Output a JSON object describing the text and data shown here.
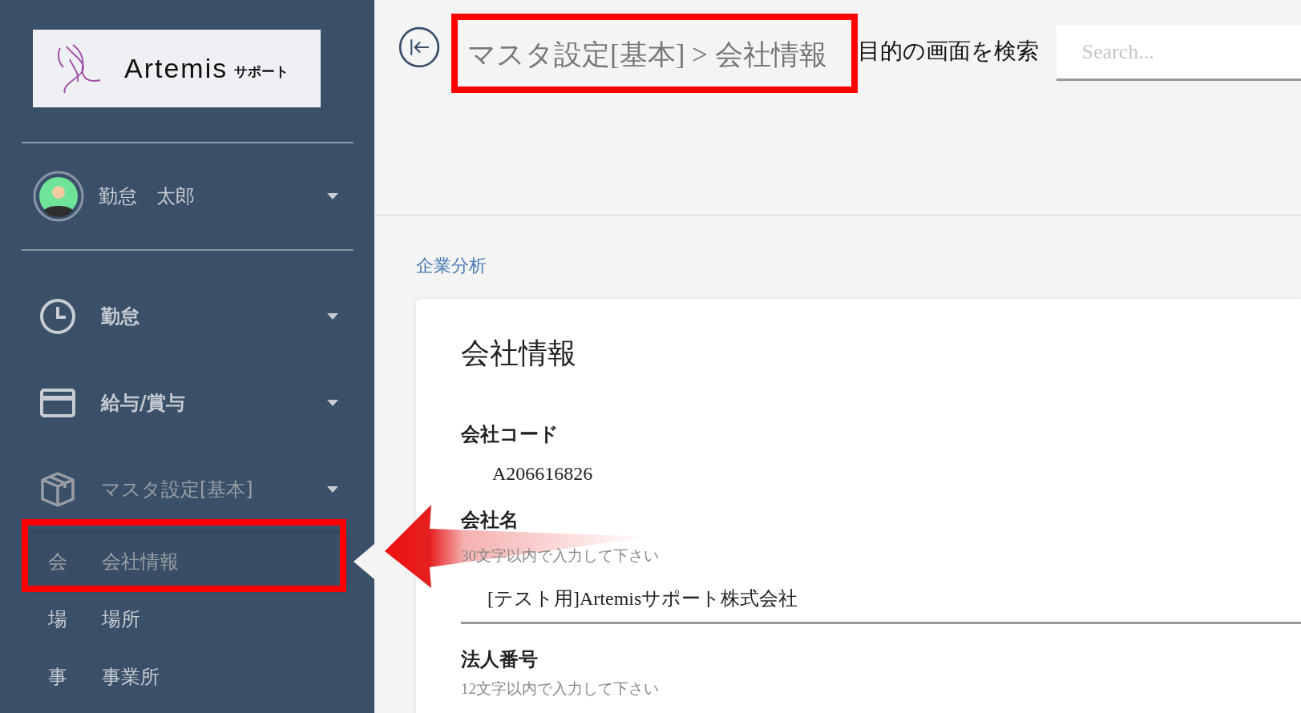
{
  "sidebar": {
    "logo": {
      "name": "Artemis",
      "suffix": "サポート"
    },
    "user": {
      "name": "勤怠　太郎"
    },
    "nav": [
      {
        "label": "勤怠",
        "kind": "clock",
        "expanded": false
      },
      {
        "label": "給与/賞与",
        "kind": "card",
        "expanded": false
      },
      {
        "label": "マスタ設定[基本]",
        "kind": "box",
        "expanded": true,
        "children": [
          {
            "initial": "会",
            "label": "会社情報",
            "selected": true
          },
          {
            "initial": "場",
            "label": "場所",
            "selected": false
          },
          {
            "initial": "事",
            "label": "事業所",
            "selected": false
          }
        ]
      }
    ]
  },
  "header": {
    "breadcrumb": "マスタ設定[基本] > 会社情報",
    "search_label": "目的の画面を検索",
    "search": {
      "placeholder": "Search..."
    }
  },
  "section_link": "企業分析",
  "card": {
    "title": "会社情報",
    "fields": [
      {
        "kind": "readonly",
        "label": "会社コード",
        "value": "A206616826"
      },
      {
        "kind": "input",
        "label": "会社名",
        "hint": "30文字以内で入力して下さい",
        "value": "[テスト用]Artemisサポート株式会社"
      },
      {
        "kind": "label",
        "label": "法人番号",
        "hint": "12文字以内で入力して下さい"
      }
    ]
  }
}
